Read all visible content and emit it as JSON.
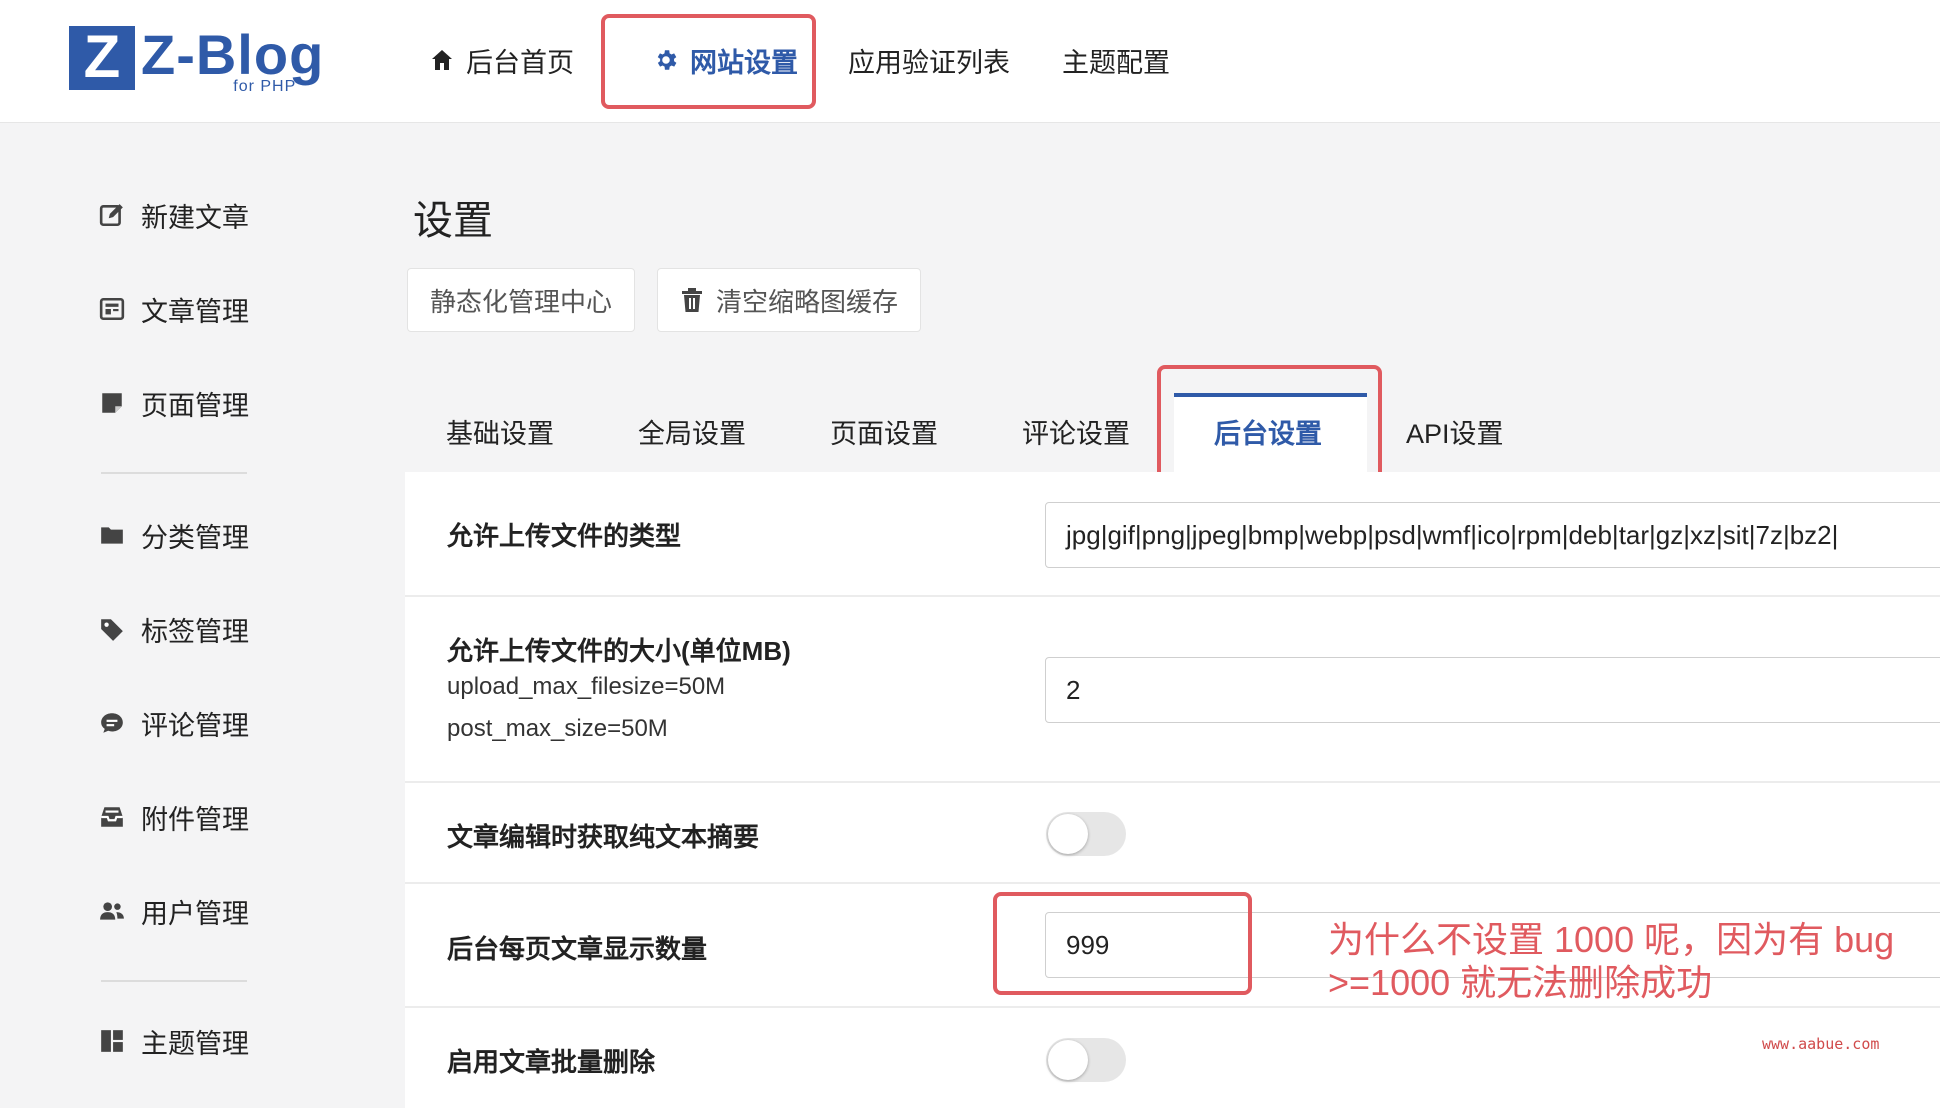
{
  "logo": {
    "mark": "Z",
    "name": "Z-Blog",
    "sub": "for PHP",
    "color": "#2f5aa8"
  },
  "topnav": {
    "home": "后台首页",
    "site_settings": "网站设置",
    "app_verify": "应用验证列表",
    "theme_config": "主题配置"
  },
  "sidebar": {
    "items": [
      {
        "label": "新建文章",
        "icon": "edit-icon"
      },
      {
        "label": "文章管理",
        "icon": "article-list-icon"
      },
      {
        "label": "页面管理",
        "icon": "page-icon"
      },
      {
        "label": "分类管理",
        "icon": "folder-icon"
      },
      {
        "label": "标签管理",
        "icon": "tag-icon"
      },
      {
        "label": "评论管理",
        "icon": "comment-icon"
      },
      {
        "label": "附件管理",
        "icon": "attachment-icon"
      },
      {
        "label": "用户管理",
        "icon": "users-icon"
      },
      {
        "label": "主题管理",
        "icon": "theme-icon"
      }
    ]
  },
  "main": {
    "title": "设置",
    "buttons": {
      "static_center": "静态化管理中心",
      "clear_thumb": "清空缩略图缓存"
    },
    "tabs": [
      "基础设置",
      "全局设置",
      "页面设置",
      "评论设置",
      "后台设置",
      "API设置"
    ],
    "active_tab": "后台设置",
    "rows": {
      "upload_types": {
        "label": "允许上传文件的类型",
        "value": "jpg|gif|png|jpeg|bmp|webp|psd|wmf|ico|rpm|deb|tar|gz|xz|sit|7z|bz2|"
      },
      "upload_size": {
        "label": "允许上传文件的大小(单位MB)",
        "sub1": "upload_max_filesize=50M",
        "sub2": "post_max_size=50M",
        "value": "2"
      },
      "plain_summary": {
        "label": "文章编辑时获取纯文本摘要",
        "enabled": false
      },
      "per_page": {
        "label": "后台每页文章显示数量",
        "value": "999"
      },
      "batch_delete": {
        "label": "启用文章批量删除",
        "enabled": false
      }
    },
    "annotation": {
      "line1": "为什么不设置 1000 呢，因为有 bug",
      "line2": ">=1000 就无法删除成功"
    },
    "watermark": "www.aabue.com"
  },
  "colors": {
    "accent": "#2f5aa8",
    "highlight": "#e05a5f"
  }
}
